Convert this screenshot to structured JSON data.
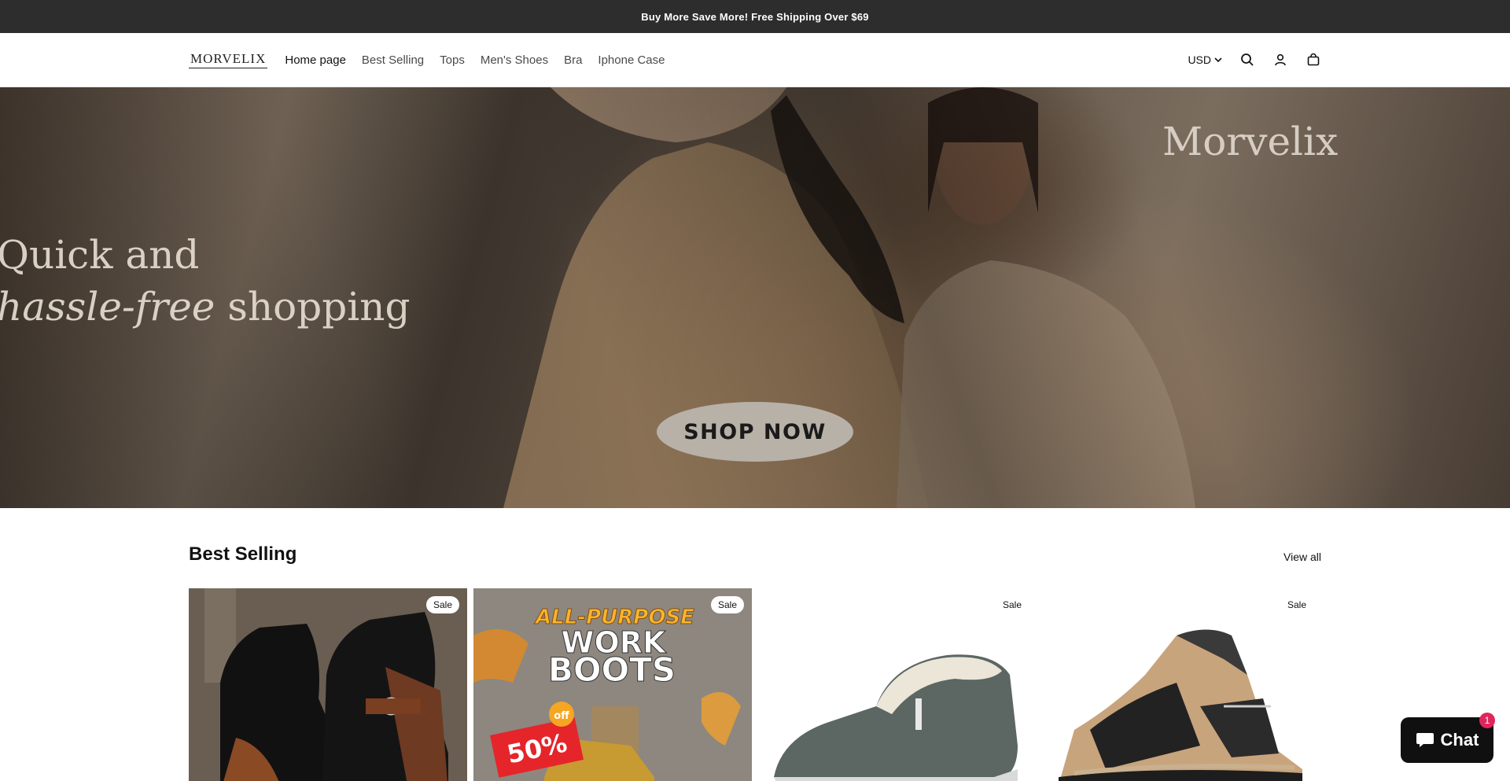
{
  "announcement": "Buy More Save More! Free Shipping Over $69",
  "header": {
    "logo": "MORVELIX",
    "nav": [
      {
        "label": "Home page",
        "active": true
      },
      {
        "label": "Best Selling",
        "active": false
      },
      {
        "label": "Tops",
        "active": false
      },
      {
        "label": "Men's Shoes",
        "active": false
      },
      {
        "label": "Bra",
        "active": false
      },
      {
        "label": "Iphone Case",
        "active": false
      }
    ],
    "currency": "USD",
    "icons": [
      "search-icon",
      "account-icon",
      "cart-icon"
    ]
  },
  "hero": {
    "line1": "Quick and",
    "line2_italic": "hassle-free",
    "line2_rest": " shopping",
    "brand": "Morvelix",
    "cta": "SHOP NOW"
  },
  "best_selling": {
    "title": "Best Selling",
    "view_all": "View all",
    "products": [
      {
        "badge": "Sale",
        "image": "black-brown-ankle-boots"
      },
      {
        "badge": "Sale",
        "image": "work-boots-promo",
        "promo_line1": "ALL-PURPOSE",
        "promo_line2": "WORK",
        "promo_line3": "BOOTS",
        "promo_discount": "50%",
        "promo_off": "off"
      },
      {
        "badge": "Sale",
        "image": "grey-fleece-slip-on-shoe"
      },
      {
        "badge": "Sale",
        "image": "tan-black-hiking-boot"
      }
    ]
  },
  "chat": {
    "label": "Chat",
    "count": "1"
  },
  "colors": {
    "announce_bg": "#2d2d2d",
    "chat_bg": "#101010",
    "badge_red": "#e0245e"
  }
}
